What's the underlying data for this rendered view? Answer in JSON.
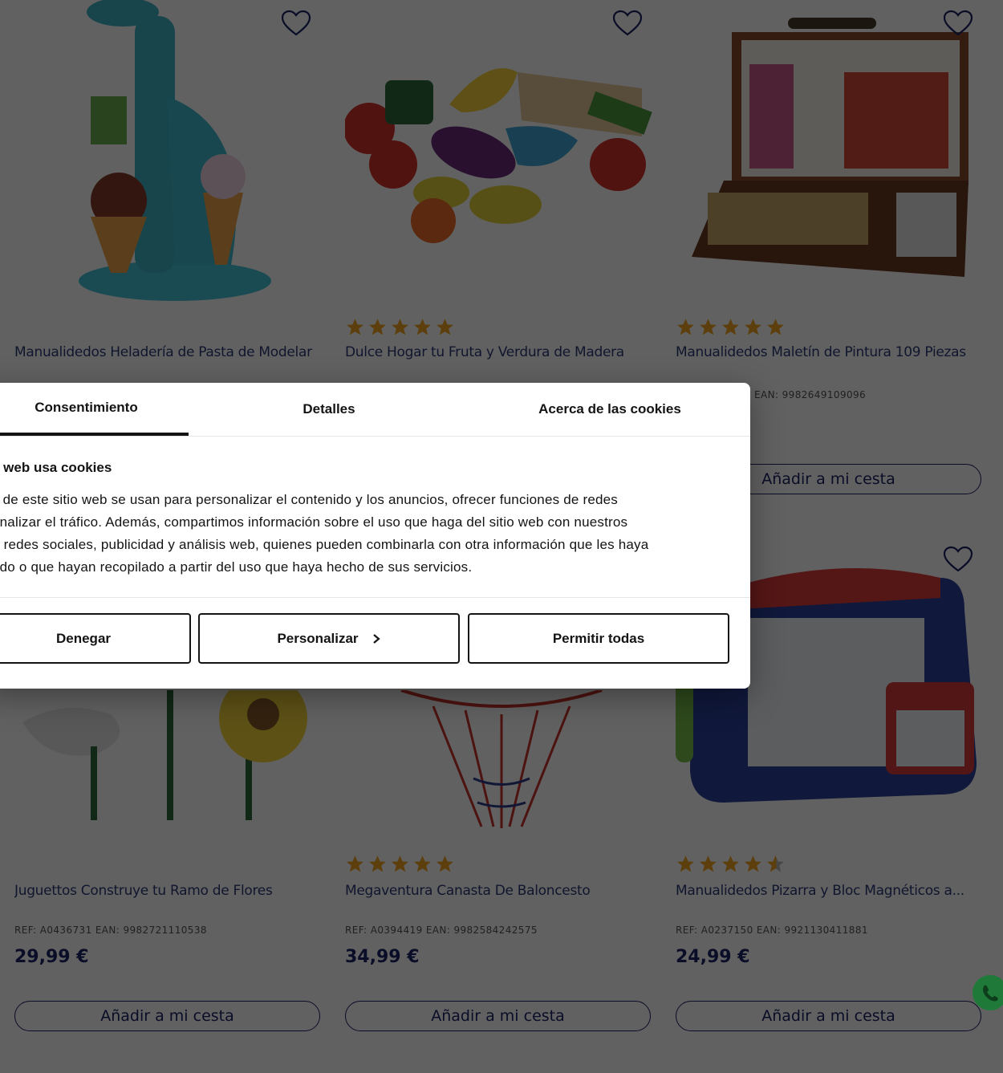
{
  "products": [
    {
      "name": "Manualidedos Heladería de Pasta de Modelar",
      "ref": "",
      "price": "",
      "button": "",
      "stars": 0
    },
    {
      "name": "Dulce Hogar tu Fruta y Verdura de Madera",
      "ref": "",
      "price": "",
      "button": "",
      "stars": 5
    },
    {
      "name": "Manualidedos Maletín de Pintura 109 Piezas",
      "ref": "EAN: 9982649109096",
      "price": "",
      "button": "Añadir a mi cesta",
      "stars": 5
    },
    {
      "name": "Juguettos Construye tu Ramo de Flores",
      "ref": "REF: A0436731 EAN: 9982721110538",
      "price": "29,99 €",
      "button": "Añadir a mi cesta",
      "stars": 0
    },
    {
      "name": "Megaventura Canasta De Baloncesto",
      "ref": "REF: A0394419 EAN: 9982584242575",
      "price": "34,99 €",
      "button": "Añadir a mi cesta",
      "stars": 5
    },
    {
      "name": "Manualidedos Pizarra y Bloc Magnéticos a...",
      "ref": "REF: A0237150 EAN: 9921130411881",
      "price": "24,99 €",
      "button": "Añadir a mi cesta",
      "stars": 4.5
    }
  ],
  "cookie_dialog": {
    "tabs": [
      "Consentimiento",
      "Detalles",
      "Acerca de las cookies"
    ],
    "title": "a web usa cookies",
    "text_lines": [
      "s de este sitio web se usan para personalizar el contenido y los anuncios, ofrecer funciones de redes",
      "analizar el tráfico. Además, compartimos información sobre el uso que haga del sitio web con nuestros",
      "e redes sociales, publicidad y análisis web, quienes pueden combinarla con otra información que les haya",
      "ado o que hayan recopilado a partir del uso que haya hecho de sus servicios."
    ],
    "buttons": {
      "deny": "Denegar",
      "customize": "Personalizar",
      "allow_all": "Permitir todas"
    }
  },
  "colors": {
    "accent": "#1c2366",
    "star": "#f5a623",
    "overlay": "rgba(0,0,0,0.62)"
  }
}
